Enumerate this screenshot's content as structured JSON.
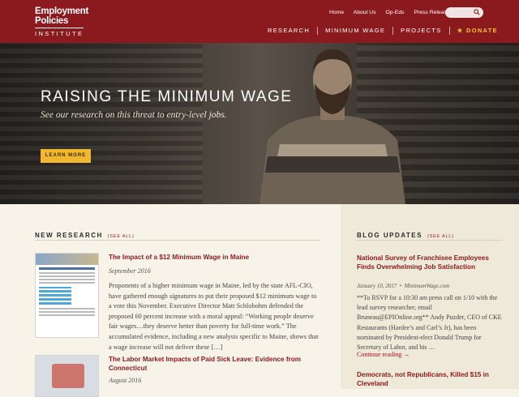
{
  "logo": {
    "line1": "Employment",
    "line2": "Policies",
    "line3": "INSTITUTE"
  },
  "toplinks": [
    "Home",
    "About Us",
    "Op-Eds",
    "Press Releases"
  ],
  "mainnav": {
    "research": "RESEARCH",
    "minimum_wage": "MINIMUM WAGE",
    "projects": "PROJECTS",
    "donate": "DONATE",
    "donate_star": "★"
  },
  "hero": {
    "title": "RAISING THE MINIMUM WAGE",
    "subtitle": "See our research on this threat to entry-level jobs.",
    "button": "LEARN MORE"
  },
  "new_research": {
    "heading": "NEW RESEARCH",
    "see_all": "(SEE ALL)",
    "articles": [
      {
        "title": "The Impact of a $12 Minimum Wage in Maine",
        "date": "September 2016",
        "body": "Proponents of a higher minimum wage in Maine, led by the state AFL-CIO, have gathered enough signatures to put their proposed $12 minimum wage to a vote this November. Executive Director Matt Schlobohm defended the proposed 60 percent increase with a moral appeal: “Working people deserve fair wages…they deserve better than poverty for full-time work.” The accumulated evidence, including a new analysis specific to Maine, shows that a wage increase will not deliver these […]"
      },
      {
        "title": "The Labor Market Impacts of Paid Sick Leave: Evidence from Connecticut",
        "date": "August 2016",
        "body": ""
      }
    ]
  },
  "blog": {
    "heading": "BLOG UPDATES",
    "see_all": "(SEE ALL)",
    "posts": [
      {
        "title": "National Survey of Franchisee Employees Finds Overwhelming Job Satisfaction",
        "date": "January 10, 2017",
        "source": "MinimumWage.com",
        "body": "**To RSVP for a 10:30 am press call on 1/10 with the lead survey researcher, email Bruneau@EPIOnline.org** Andy Puzder, CEO of CKE Restaurants (Hardee’s and Carl’s Jr), has been nominated by President-elect Donald Trump for Secretary of Labor, and his …",
        "continue": "Continue reading →"
      },
      {
        "title": "Democrats, not Republicans, Killed $15 in Cleveland"
      }
    ]
  },
  "colors": {
    "brand": "#8b1a1e",
    "accent": "#f2b82d",
    "background": "#f7f3e9",
    "sidebar": "#efe9d9"
  }
}
